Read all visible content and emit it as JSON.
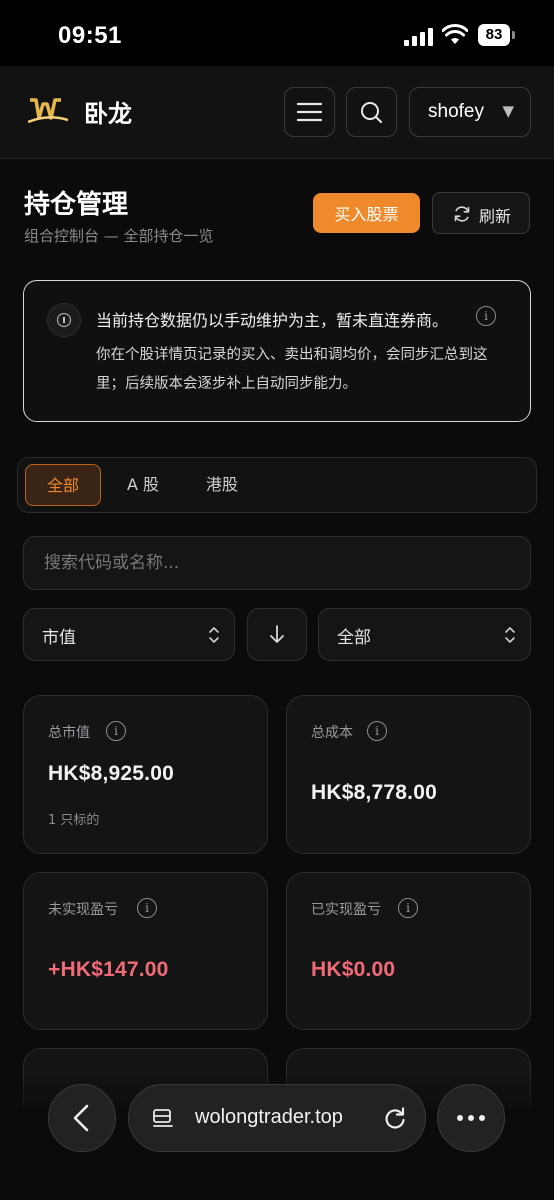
{
  "status": {
    "time": "09:51",
    "battery": "83"
  },
  "header": {
    "brand": "卧龙",
    "user": "shofey"
  },
  "page": {
    "title": "持仓管理",
    "subtitle": "组合控制台 — 全部持仓一览",
    "buy_label": "买入股票",
    "refresh_label": "刷新"
  },
  "notice": {
    "title": "当前持仓数据仍以手动维护为主，暂未直连券商。",
    "body": "你在个股详情页记录的买入、卖出和调均价，会同步汇总到这里；后续版本会逐步补上自动同步能力。"
  },
  "tabs": [
    {
      "label": "全部",
      "active": true
    },
    {
      "label": "A 股",
      "active": false
    },
    {
      "label": "港股",
      "active": false
    }
  ],
  "search": {
    "placeholder": "搜索代码或名称..."
  },
  "filters": {
    "sort_by": "市值",
    "market": "全部"
  },
  "cards": [
    {
      "label": "总市值",
      "value": "HK$8,925.00",
      "sub": "1 只标的"
    },
    {
      "label": "总成本",
      "value": "HK$8,778.00"
    },
    {
      "label": "未实现盈亏",
      "value": "+HK$147.00"
    },
    {
      "label": "已实现盈亏",
      "value": "HK$0.00"
    }
  ],
  "browser": {
    "url": "wolongtrader.top"
  },
  "colors": {
    "accent": "#ef8a2c",
    "loss_red": "#f06a78",
    "background": "#0b0b0c"
  }
}
